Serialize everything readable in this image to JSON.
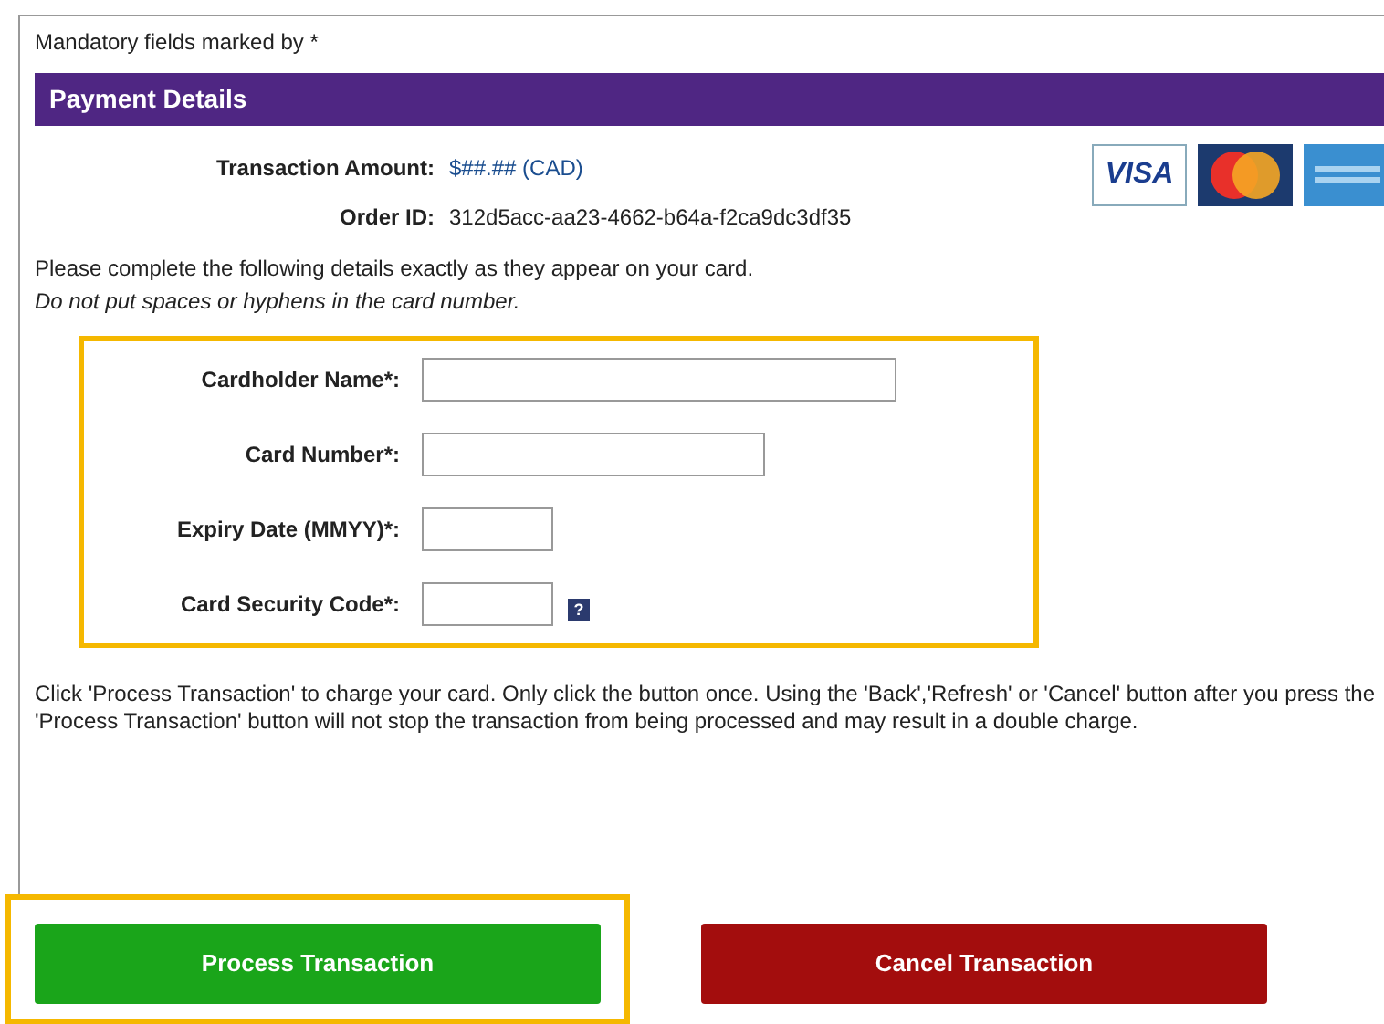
{
  "mandatory_note": "Mandatory fields marked by *",
  "section_title": "Payment Details",
  "summary": [
    {
      "label": "Transaction Amount:",
      "value": "$##.## (CAD)",
      "highlight": true
    },
    {
      "label": "Order ID:",
      "value": "312d5acc-aa23-4662-b64a-f2ca9dc3df35",
      "highlight": false
    }
  ],
  "card_logos": [
    {
      "kind": "visa",
      "text": "VISA"
    },
    {
      "kind": "mastercard"
    },
    {
      "kind": "amex"
    }
  ],
  "instructions": "Please complete the following details exactly as they appear on your card.",
  "instructions_note": "Do not put spaces or hyphens in the card number.",
  "form": {
    "highlighted": true,
    "fields": [
      {
        "label": "Cardholder Name*:",
        "kind": "long"
      },
      {
        "label": "Card Number*:",
        "kind": "medium"
      },
      {
        "label": "Expiry Date (MMYY)*:",
        "kind": "short"
      },
      {
        "label": "Card Security Code*:",
        "kind": "short",
        "help": "?"
      }
    ]
  },
  "warning": "Click 'Process Transaction' to charge your card. Only click the button once. Using the 'Back','Refresh' or 'Cancel' button after you press the 'Process Transaction' button will not stop the transaction from being processed and may result in a double charge.",
  "buttons": [
    {
      "label": "Process Transaction",
      "kind": "primary",
      "highlighted": true
    },
    {
      "label": "Cancel Transaction",
      "kind": "danger",
      "highlighted": false
    }
  ]
}
